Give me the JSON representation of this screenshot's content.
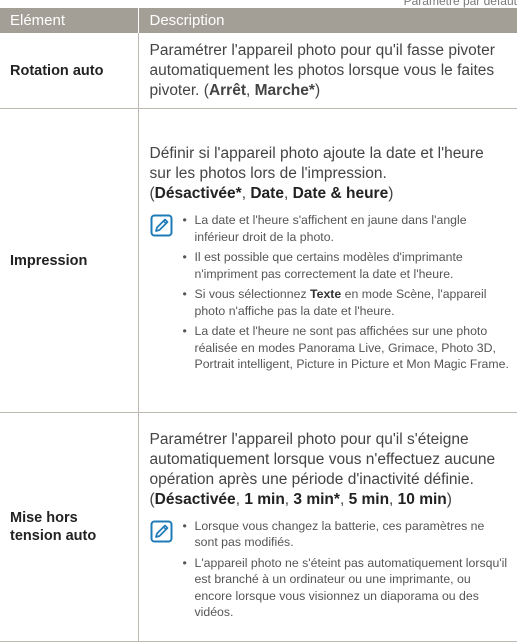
{
  "header_note": "Paramètre par défaut",
  "columns": {
    "element": "Elément",
    "description": "Description"
  },
  "rows": [
    {
      "name": "Rotation auto",
      "desc": "Paramétrer l'appareil photo pour qu'il fasse pivoter automatiquement les photos lorsque vous le faites pivoter.",
      "options": [
        "Arrêt",
        "Marche*"
      ]
    },
    {
      "name": "Impression",
      "desc": "Définir si l'appareil photo ajoute la date et l'heure sur les photos lors de l'impression.",
      "options": [
        "Désactivée*",
        "Date",
        "Date & heure"
      ],
      "note_icon": "note-pencil-icon",
      "notes": [
        "La date et l'heure s'affichent en jaune dans l'angle inférieur droit de la photo.",
        "Il est possible que certains modèles d'imprimante n'impriment pas correctement la date et l'heure.",
        "Si vous sélectionnez Texte en mode Scène, l'appareil photo n'affiche pas la date et l'heure.",
        "La date et l'heure ne sont pas affichées sur une photo réalisée en modes Panorama Live, Grimace, Photo 3D, Portrait intelligent, Picture in Picture et Mon Magic Frame."
      ]
    },
    {
      "name": "Mise hors tension auto",
      "desc": "Paramétrer l'appareil photo pour qu'il s'éteigne automatiquement lorsque vous n'effectuez aucune opération après une période d'inactivité définie.",
      "options": [
        "Désactivée",
        "1 min",
        "3 min*",
        "5 min",
        "10 min"
      ],
      "note_icon": "note-pencil-icon",
      "notes": [
        "Lorsque vous changez la batterie, ces paramètres ne sont pas modifiés.",
        "L'appareil photo ne s'éteint pas automatiquement lorsqu'il est branché à un ordinateur ou une imprimante, ou encore lorsque vous visionnez un diaporama ou des vidéos."
      ]
    }
  ]
}
